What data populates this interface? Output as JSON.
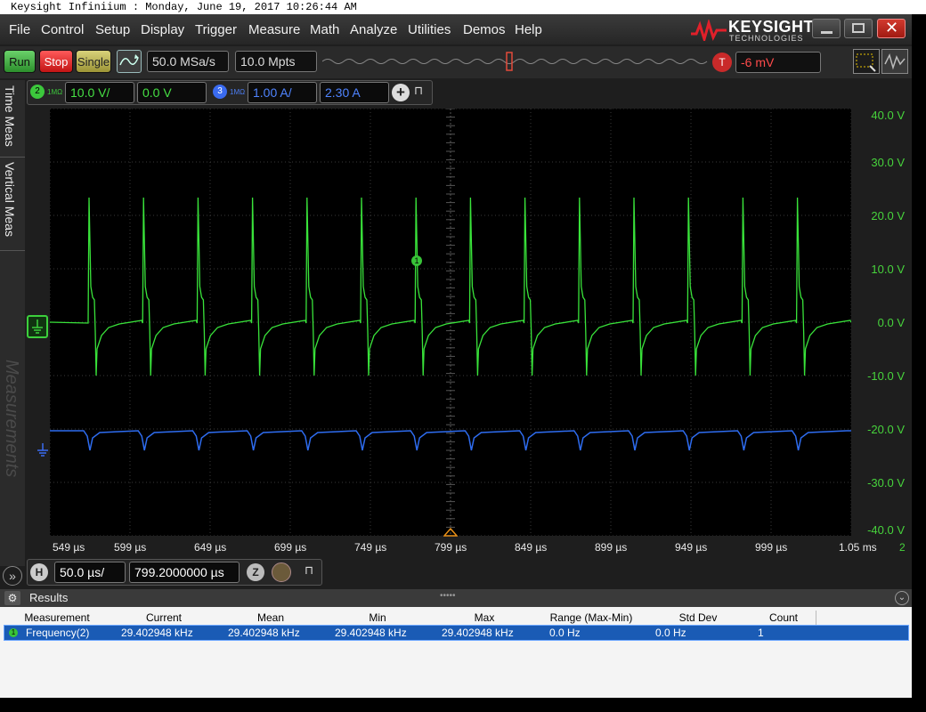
{
  "os_title": "Keysight Infiniium : Monday, June 19, 2017 10:26:44 AM",
  "menu": [
    "File",
    "Control",
    "Setup",
    "Display",
    "Trigger",
    "Measure",
    "Math",
    "Analyze",
    "Utilities",
    "Demos",
    "Help"
  ],
  "brand": {
    "name": "KEYSIGHT",
    "sub": "TECHNOLOGIES"
  },
  "toolbar": {
    "run": "Run",
    "stop": "Stop",
    "single": "Single",
    "sample_rate": "50.0 MSa/s",
    "memory_depth": "10.0 Mpts",
    "trigger_badge": "T",
    "trigger_level": "-6 mV"
  },
  "channels": {
    "ch2": {
      "badge": "2",
      "imp": "1MΩ",
      "scale": "10.0 V/",
      "offset": "0.0 V"
    },
    "ch3": {
      "badge": "3",
      "imp": "1MΩ",
      "scale": "1.00 A/",
      "offset": "2.30 A"
    }
  },
  "left_tabs": {
    "time": "Time Meas",
    "vertical": "Vertical Meas",
    "measurements": "Measurements"
  },
  "marker_badge": "1",
  "y_axis_labels": [
    "40.0 V",
    "30.0 V",
    "20.0 V",
    "10.0 V",
    "0.0 V",
    "-10.0 V",
    "-20.0 V",
    "-30.0 V",
    "-40.0 V"
  ],
  "x_axis_labels": [
    "549 µs",
    "599 µs",
    "649 µs",
    "699 µs",
    "749 µs",
    "799 µs",
    "849 µs",
    "899 µs",
    "949 µs",
    "999 µs",
    "1.05 ms"
  ],
  "x_axis_page": "2",
  "horizontal": {
    "badge": "H",
    "scale": "50.0 µs/",
    "position": "799.2000000 µs"
  },
  "results": {
    "title": "Results",
    "columns": [
      "Measurement",
      "Current",
      "Mean",
      "Min",
      "Max",
      "Range (Max-Min)",
      "Std Dev",
      "Count"
    ],
    "rows": [
      {
        "badge": "1",
        "values": [
          "Frequency(2)",
          "29.402948 kHz",
          "29.402948 kHz",
          "29.402948 kHz",
          "29.402948 kHz",
          "0.0 Hz",
          "0.0 Hz",
          "1"
        ]
      }
    ]
  },
  "colors": {
    "ch2": "#39e33a",
    "ch3": "#2e6cf0",
    "accent_red": "#d32020",
    "grid": "#3a3a3a"
  }
}
